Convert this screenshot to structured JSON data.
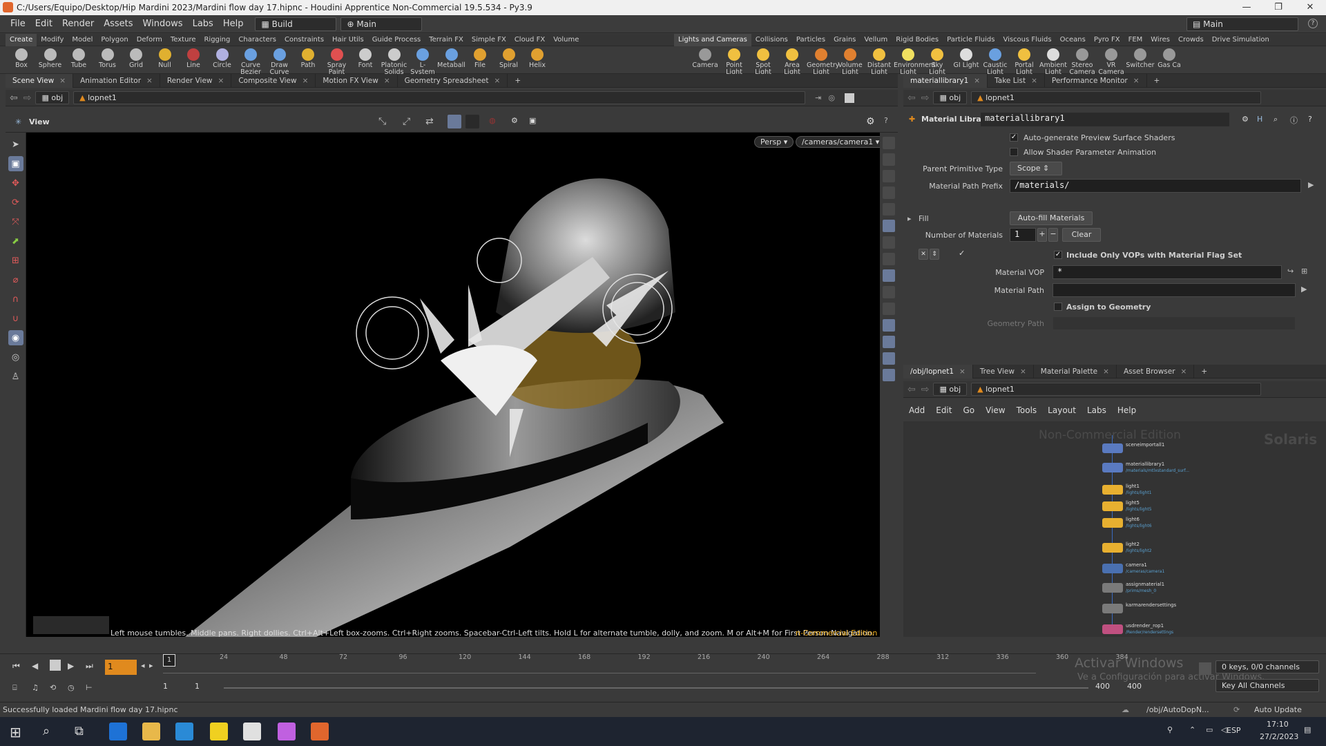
{
  "titlebar": {
    "title": "C:/Users/Equipo/Desktop/Hip Mardini 2023/Mardini flow day 17.hipnc - Houdini Apprentice Non-Commercial 19.5.534 - Py3.9",
    "min": "—",
    "max": "❐",
    "close": "✕"
  },
  "menu": [
    "File",
    "Edit",
    "Render",
    "Assets",
    "Windows",
    "Labs",
    "Help"
  ],
  "desktop_build": "Build",
  "desktop_main": "Main",
  "desktop_main_right": "Main",
  "shelf_tabs_left": [
    "Create",
    "Modify",
    "Model",
    "Polygon",
    "Deform",
    "Texture",
    "Rigging",
    "Characters",
    "Constraints",
    "Hair Utils",
    "Guide Process",
    "Terrain FX",
    "Simple FX",
    "Cloud FX",
    "Volume"
  ],
  "shelf_tabs_right": [
    "Lights and Cameras",
    "Collisions",
    "Particles",
    "Grains",
    "Vellum",
    "Rigid Bodies",
    "Particle Fluids",
    "Viscous Fluids",
    "Oceans",
    "Pyro FX",
    "FEM",
    "Wires",
    "Crowds",
    "Drive Simulation"
  ],
  "tools_left": [
    {
      "label": "Box",
      "color": "#bbbbbb"
    },
    {
      "label": "Sphere",
      "color": "#bbbbbb"
    },
    {
      "label": "Tube",
      "color": "#bbbbbb"
    },
    {
      "label": "Torus",
      "color": "#bbbbbb"
    },
    {
      "label": "Grid",
      "color": "#bbbbbb"
    },
    {
      "label": "Null",
      "color": "#e0b030"
    },
    {
      "label": "Line",
      "color": "#c04040"
    },
    {
      "label": "Circle",
      "color": "#b0b0e0"
    },
    {
      "label": "Curve Bezier",
      "color": "#6aa0e0"
    },
    {
      "label": "Draw Curve",
      "color": "#6aa0e0"
    },
    {
      "label": "Path",
      "color": "#e0b030"
    },
    {
      "label": "Spray Paint",
      "color": "#e05050"
    },
    {
      "label": "Font",
      "color": "#cccccc"
    },
    {
      "label": "Platonic Solids",
      "color": "#cccccc"
    },
    {
      "label": "L-System",
      "color": "#6aa0e0"
    },
    {
      "label": "Metaball",
      "color": "#6aa0e0"
    },
    {
      "label": "File",
      "color": "#e0a030"
    },
    {
      "label": "Spiral",
      "color": "#e0a030"
    },
    {
      "label": "Helix",
      "color": "#e0a030"
    }
  ],
  "tools_right": [
    {
      "label": "Camera",
      "color": "#999999"
    },
    {
      "label": "Point Light",
      "color": "#f0c040"
    },
    {
      "label": "Spot Light",
      "color": "#f0c040"
    },
    {
      "label": "Area Light",
      "color": "#f0c040"
    },
    {
      "label": "Geometry Light",
      "color": "#e08030"
    },
    {
      "label": "Volume Light",
      "color": "#e08030"
    },
    {
      "label": "Distant Light",
      "color": "#f0c040"
    },
    {
      "label": "Environment Light",
      "color": "#f0e060"
    },
    {
      "label": "Sky Light",
      "color": "#f0c040"
    },
    {
      "label": "GI Light",
      "color": "#dddddd"
    },
    {
      "label": "Caustic Light",
      "color": "#6aa0e0"
    },
    {
      "label": "Portal Light",
      "color": "#f0c040"
    },
    {
      "label": "Ambient Light",
      "color": "#dddddd"
    },
    {
      "label": "Stereo Camera",
      "color": "#999999"
    },
    {
      "label": "VR Camera",
      "color": "#999999"
    },
    {
      "label": "Switcher",
      "color": "#999999"
    },
    {
      "label": "Gas Ca",
      "color": "#999999"
    }
  ],
  "left_pane_tabs": [
    "Scene View",
    "Animation Editor",
    "Render View",
    "Composite View",
    "Motion FX View",
    "Geometry Spreadsheet"
  ],
  "right_top_tabs": [
    "materiallibrary1",
    "Take List",
    "Performance Monitor"
  ],
  "path": {
    "root": "obj",
    "node": "lopnet1"
  },
  "view": {
    "label": "View",
    "persp": "Persp ▾",
    "camera": "/cameras/camera1 ▾",
    "hint": "Left mouse tumbles. Middle pans. Right dollies. Ctrl+Alt+Left box-zooms. Ctrl+Right zooms. Spacebar-Ctrl-Left tilts. Hold L for alternate tumble, dolly, and zoom.    M or Alt+M for First Person Navigation.",
    "watermark": "n-Commercial Edition"
  },
  "params": {
    "type": "Material Library",
    "name": "materiallibrary1",
    "auto_preview": "Auto-generate Preview Surface Shaders",
    "allow_anim": "Allow Shader Parameter Animation",
    "parent_prim_label": "Parent Primitive Type",
    "parent_prim_value": "Scope",
    "path_prefix_label": "Material Path Prefix",
    "path_prefix_value": "/materials/",
    "fill_label": "Fill",
    "autofill": "Auto-fill Materials",
    "num_mat_label": "Number of Materials",
    "num_mat_value": "1",
    "clear": "Clear",
    "include_only": "Include Only VOPs with Material Flag Set",
    "mat_vop_label": "Material VOP",
    "mat_vop_value": "*",
    "mat_path_label": "Material Path",
    "assign_geo": "Assign to Geometry",
    "geo_path_label": "Geometry Path"
  },
  "net_tabs": [
    "/obj/lopnet1",
    "Tree View",
    "Material Palette",
    "Asset Browser"
  ],
  "net_menu": [
    "Add",
    "Edit",
    "Go",
    "View",
    "Tools",
    "Layout",
    "Labs",
    "Help"
  ],
  "network": {
    "watermark": "Non-Commercial Edition",
    "context": "Solaris",
    "nodes": [
      {
        "name": "sceneimportall1",
        "color": "#5a7ac0",
        "sub": ""
      },
      {
        "name": "materiallibrary1",
        "color": "#5a7ac0",
        "sub": "/materials/mtlxstandard_surf..."
      },
      {
        "name": "light1",
        "color": "#e8b030",
        "sub": "/lights/light1"
      },
      {
        "name": "light5",
        "color": "#e8b030",
        "sub": "/lights/light5"
      },
      {
        "name": "light6",
        "color": "#e8b030",
        "sub": "/lights/light6"
      },
      {
        "name": "light2",
        "color": "#e8b030",
        "sub": "/lights/light2"
      },
      {
        "name": "camera1",
        "color": "#4a70b0",
        "sub": "/cameras/camera1"
      },
      {
        "name": "assignmaterial1",
        "color": "#7a7a7a",
        "sub": "/prims/mesh_0"
      },
      {
        "name": "karmarendersettings",
        "color": "#7a7a7a",
        "sub": ""
      },
      {
        "name": "usdrender_rop1",
        "color": "#c05080",
        "sub": "/Render/rendersettings"
      }
    ]
  },
  "timeline": {
    "ticks": [
      "24",
      "48",
      "72",
      "96",
      "120",
      "144",
      "168",
      "192",
      "216",
      "240",
      "264",
      "288",
      "312",
      "336",
      "360",
      "384"
    ],
    "current_frame": "1",
    "frame_marker": "1",
    "start": "1",
    "start2": "1",
    "end": "400",
    "end2": "400",
    "keys": "0 keys, 0/0 channels",
    "key_all": "Key All Channels",
    "activate": "Activar Windows",
    "activate_sub": "Ve a Configuración para activar Windows."
  },
  "status": {
    "message": "Successfully loaded Mardini flow day 17.hipnc",
    "path": "/obj/AutoDopN...",
    "update": "Auto Update"
  },
  "taskbar": {
    "lang": "ESP",
    "time": "17:10",
    "date": "27/2/2023"
  },
  "colors": {
    "accent_orange": "#e08a1e",
    "viewport_bg": "#000000"
  }
}
